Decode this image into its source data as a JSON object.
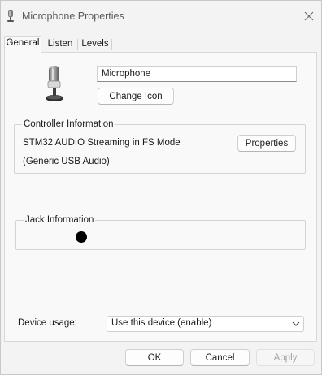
{
  "window": {
    "title": "Microphone Properties",
    "close_icon": "close-icon",
    "title_icon": "microphone-icon"
  },
  "tabs": [
    {
      "label": "General",
      "active": true
    },
    {
      "label": "Listen",
      "active": false
    },
    {
      "label": "Levels",
      "active": false
    }
  ],
  "general": {
    "device_icon": "microphone-icon",
    "device_name": "Microphone",
    "change_icon_label": "Change Icon",
    "controller": {
      "group_label": "Controller Information",
      "name": "STM32 AUDIO Streaming in FS Mode",
      "driver": "(Generic USB Audio)",
      "properties_label": "Properties"
    },
    "jack": {
      "group_label": "Jack Information",
      "dot_color": "#000000"
    },
    "device_usage": {
      "label": "Device usage:",
      "selected": "Use this device (enable)"
    }
  },
  "footer": {
    "ok_label": "OK",
    "cancel_label": "Cancel",
    "apply_label": "Apply"
  }
}
